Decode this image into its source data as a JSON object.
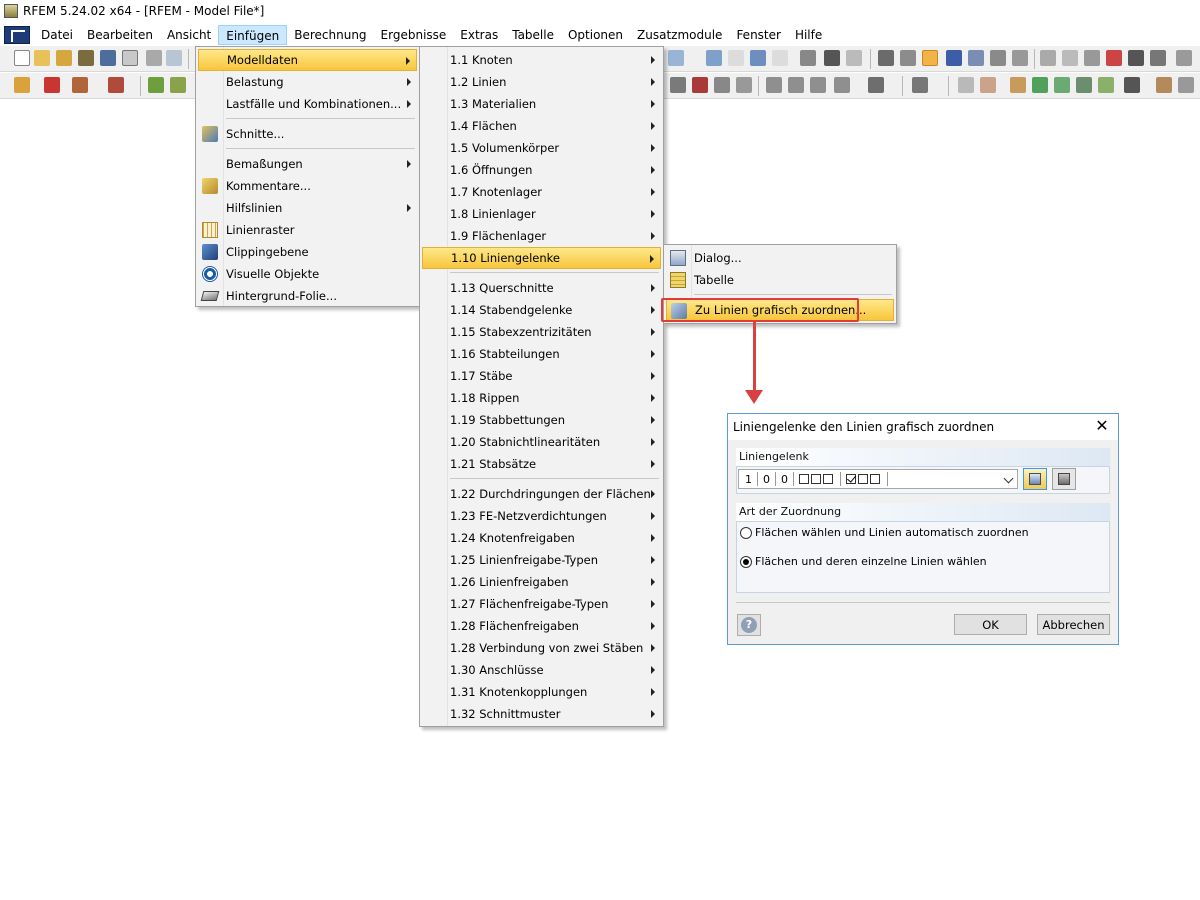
{
  "window": {
    "title": "RFEM 5.24.02 x64 - [RFEM - Model File*]"
  },
  "menubar": {
    "items": [
      "Datei",
      "Bearbeiten",
      "Ansicht",
      "Einfügen",
      "Berechnung",
      "Ergebnisse",
      "Extras",
      "Tabelle",
      "Optionen",
      "Zusatzmodule",
      "Fenster",
      "Hilfe"
    ],
    "active": "Einfügen"
  },
  "menu_einfuegen": {
    "items": [
      {
        "label": "Modelldaten",
        "submenu": true,
        "highlighted": true
      },
      {
        "label": "Belastung",
        "submenu": true
      },
      {
        "label": "Lastfälle und Kombinationen...",
        "submenu": true
      },
      {
        "label": "Schnitte...",
        "icon": "section-icon"
      },
      {
        "label": "Bemaßungen",
        "submenu": true
      },
      {
        "label": "Kommentare...",
        "icon": "comment-icon"
      },
      {
        "label": "Hilfslinien",
        "submenu": true
      },
      {
        "label": "Linienraster",
        "icon": "grid-icon"
      },
      {
        "label": "Clippingebene",
        "icon": "clipping-plane-icon"
      },
      {
        "label": "Visuelle Objekte",
        "icon": "visual-objects-icon"
      },
      {
        "label": "Hintergrund-Folie...",
        "icon": "background-layer-icon"
      }
    ]
  },
  "menu_modelldaten": {
    "items": [
      "1.1 Knoten",
      "1.2 Linien",
      "1.3 Materialien",
      "1.4 Flächen",
      "1.5 Volumenkörper",
      "1.6 Öffnungen",
      "1.7 Knotenlager",
      "1.8 Linienlager",
      "1.9 Flächenlager",
      "1.10 Liniengelenke",
      "1.13 Querschnitte",
      "1.14 Stabendgelenke",
      "1.15 Stabexzentrizitäten",
      "1.16 Stabteilungen",
      "1.17 Stäbe",
      "1.18 Rippen",
      "1.19 Stabbettungen",
      "1.20 Stabnichtlinearitäten",
      "1.21 Stabsätze",
      "1.22 Durchdringungen der Flächen",
      "1.23 FE-Netzverdichtungen",
      "1.24 Knotenfreigaben",
      "1.25 Linienfreigabe-Typen",
      "1.26 Linienfreigaben",
      "1.27 Flächenfreigabe-Typen",
      "1.28 Flächenfreigaben",
      "1.28 Verbindung von zwei Stäben",
      "1.30 Anschlüsse",
      "1.31 Knotenkopplungen",
      "1.32 Schnittmuster"
    ],
    "highlighted": "1.10 Liniengelenke"
  },
  "menu_liniengelenke": {
    "items": [
      {
        "label": "Dialog...",
        "icon": "dialog-icon"
      },
      {
        "label": "Tabelle",
        "icon": "table-icon"
      },
      {
        "label": "Zu Linien grafisch zuordnen...",
        "icon": "assign-graphically-icon",
        "highlighted": true
      }
    ]
  },
  "dialog": {
    "title": "Liniengelenke den Linien grafisch zuordnen",
    "group1": {
      "title": "Liniengelenk",
      "combo": {
        "no": "1",
        "v1": "0",
        "v2": "0"
      }
    },
    "group2": {
      "title": "Art der Zuordnung",
      "option1": "Flächen wählen und Linien automatisch zuordnen",
      "option2": "Flächen und deren einzelne Linien wählen",
      "selected": 2
    },
    "ok_label": "OK",
    "cancel_label": "Abbrechen"
  },
  "colors": {
    "highlight": "#f7c63c",
    "annotation": "#e03c3c",
    "dialog_border": "#5b9bd5"
  }
}
